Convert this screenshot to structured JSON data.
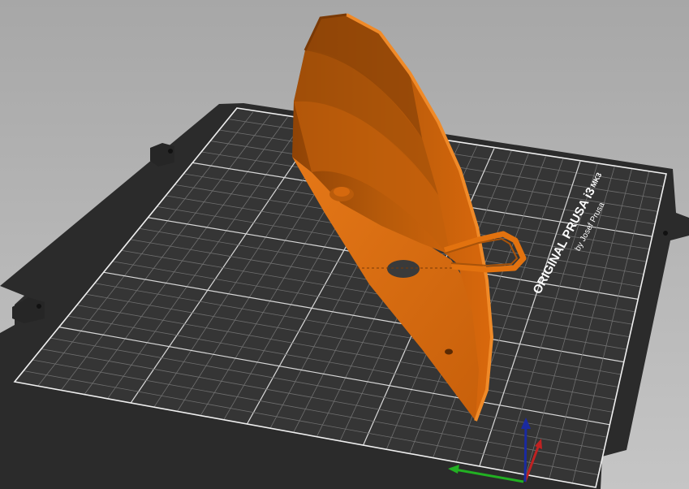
{
  "app": {
    "view": "3D plater viewport"
  },
  "bed": {
    "brand_text": "ORIGINAL PRUSA i3",
    "model_suffix": "MK3",
    "maker_text": "by Josef Prusa",
    "plate_color": "#2d2d2d",
    "sheet_color": "#333333",
    "grid_color": "#7a7a7a",
    "border_color": "#f2f2f2"
  },
  "model": {
    "name": "orange-part",
    "color": "#d9680c",
    "shade_dark": "#8f4306",
    "shade_mid": "#b65a0a",
    "shade_light": "#e77a1a"
  },
  "axes": {
    "x_color": "#20b020",
    "y_color": "#c02020",
    "z_color": "#1a2aa0"
  },
  "colors": {
    "background_top": "#a9a9a9",
    "background_bottom": "#c4c4c4"
  }
}
